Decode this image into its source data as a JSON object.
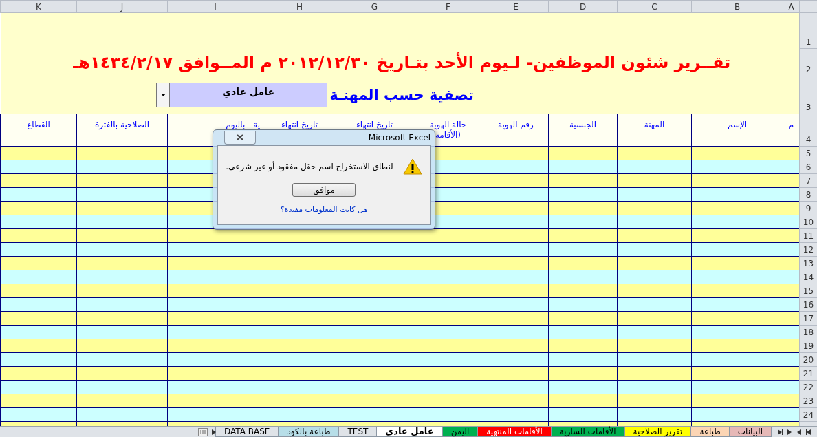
{
  "columns": [
    "A",
    "B",
    "C",
    "D",
    "E",
    "F",
    "G",
    "H",
    "I",
    "J",
    "K"
  ],
  "title": "تقــرير شئون الموظفين- لـيوم  الأحد بتـاريخ  ٢٠١٢/١٢/٣٠ م المــوافق  ١٤٣٤/٢/١٧هـ",
  "filter": {
    "label": "تصفية حسب المهنـة",
    "value": "عامل عادي"
  },
  "headers": [
    {
      "text": "م",
      "partly_hidden": false
    },
    {
      "text": "الإسم",
      "partly_hidden": false
    },
    {
      "text": "المهنة",
      "partly_hidden": false
    },
    {
      "text": "الجنسية",
      "partly_hidden": false
    },
    {
      "text": "رقم الهوية",
      "partly_hidden": false
    },
    {
      "text": "حالة الهوية (الأقامة",
      "partly_hidden": false
    },
    {
      "text": "تاريخ انتهاء",
      "partly_hidden": false
    },
    {
      "text": "تاريخ انتهاء",
      "partly_hidden": false
    },
    {
      "text": "ية - باليوم",
      "partly_hidden": true
    },
    {
      "text": "الصلاحية بالفترة",
      "partly_hidden": false
    },
    {
      "text": "القطاع",
      "partly_hidden": false
    }
  ],
  "row_numbers": [
    "1",
    "2",
    "3",
    "4",
    "5",
    "6",
    "7",
    "8",
    "9",
    "10",
    "11",
    "12",
    "13",
    "14",
    "15",
    "16",
    "17",
    "18",
    "19",
    "20",
    "21",
    "22",
    "23",
    "24"
  ],
  "dialog": {
    "title": "Microsoft Excel",
    "message": "لنطاق الاستخراج اسم حقل مفقود أو غير شرعي.",
    "button": "موافق",
    "link": "هل كانت المعلومات مفيدة؟"
  },
  "sheet_tabs": [
    {
      "label": "البيانات",
      "color": "#e6b8b7",
      "selected": false
    },
    {
      "label": "طباعة",
      "color": "#fcd5b4",
      "selected": false
    },
    {
      "label": "تقرير الصلاحية",
      "color": "#ffff00",
      "selected": false
    },
    {
      "label": "الأقامات السارية",
      "color": "#00b050",
      "selected": false
    },
    {
      "label": "الأقامات المنتهية",
      "color": "#ff0000",
      "selected": false
    },
    {
      "label": "اليمن",
      "color": "#00b050",
      "selected": false
    },
    {
      "label": "عامل عادي",
      "color": "#ffffff",
      "selected": true
    },
    {
      "label": "TEST",
      "color": "#dfe3e8",
      "selected": false
    },
    {
      "label": "طباعة بالكود",
      "color": "#b7dee8",
      "selected": false
    },
    {
      "label": "DATA BASE",
      "color": "#dfe3e8",
      "selected": false
    }
  ]
}
